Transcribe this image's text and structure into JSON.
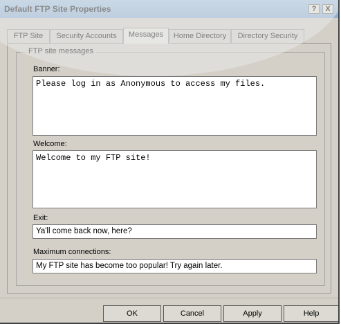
{
  "window": {
    "title": "Default FTP Site Properties",
    "help_button": "?",
    "close_button": "X"
  },
  "tabs": [
    {
      "label": "FTP Site",
      "active": false
    },
    {
      "label": "Security Accounts",
      "active": false
    },
    {
      "label": "Messages",
      "active": true
    },
    {
      "label": "Home Directory",
      "active": false
    },
    {
      "label": "Directory Security",
      "active": false
    }
  ],
  "messages": {
    "group_title": "FTP site messages",
    "banner_label": "Banner:",
    "banner_value": "Please log in as Anonymous to access my files.",
    "welcome_label": "Welcome:",
    "welcome_value": "Welcome to my FTP site!",
    "exit_label": "Exit:",
    "exit_value": "Ya'll come back now, here?",
    "max_label": "Maximum connections:",
    "max_value": "My FTP site has become too popular! Try again later."
  },
  "buttons": {
    "ok": "OK",
    "cancel": "Cancel",
    "apply": "Apply",
    "help": "Help"
  }
}
